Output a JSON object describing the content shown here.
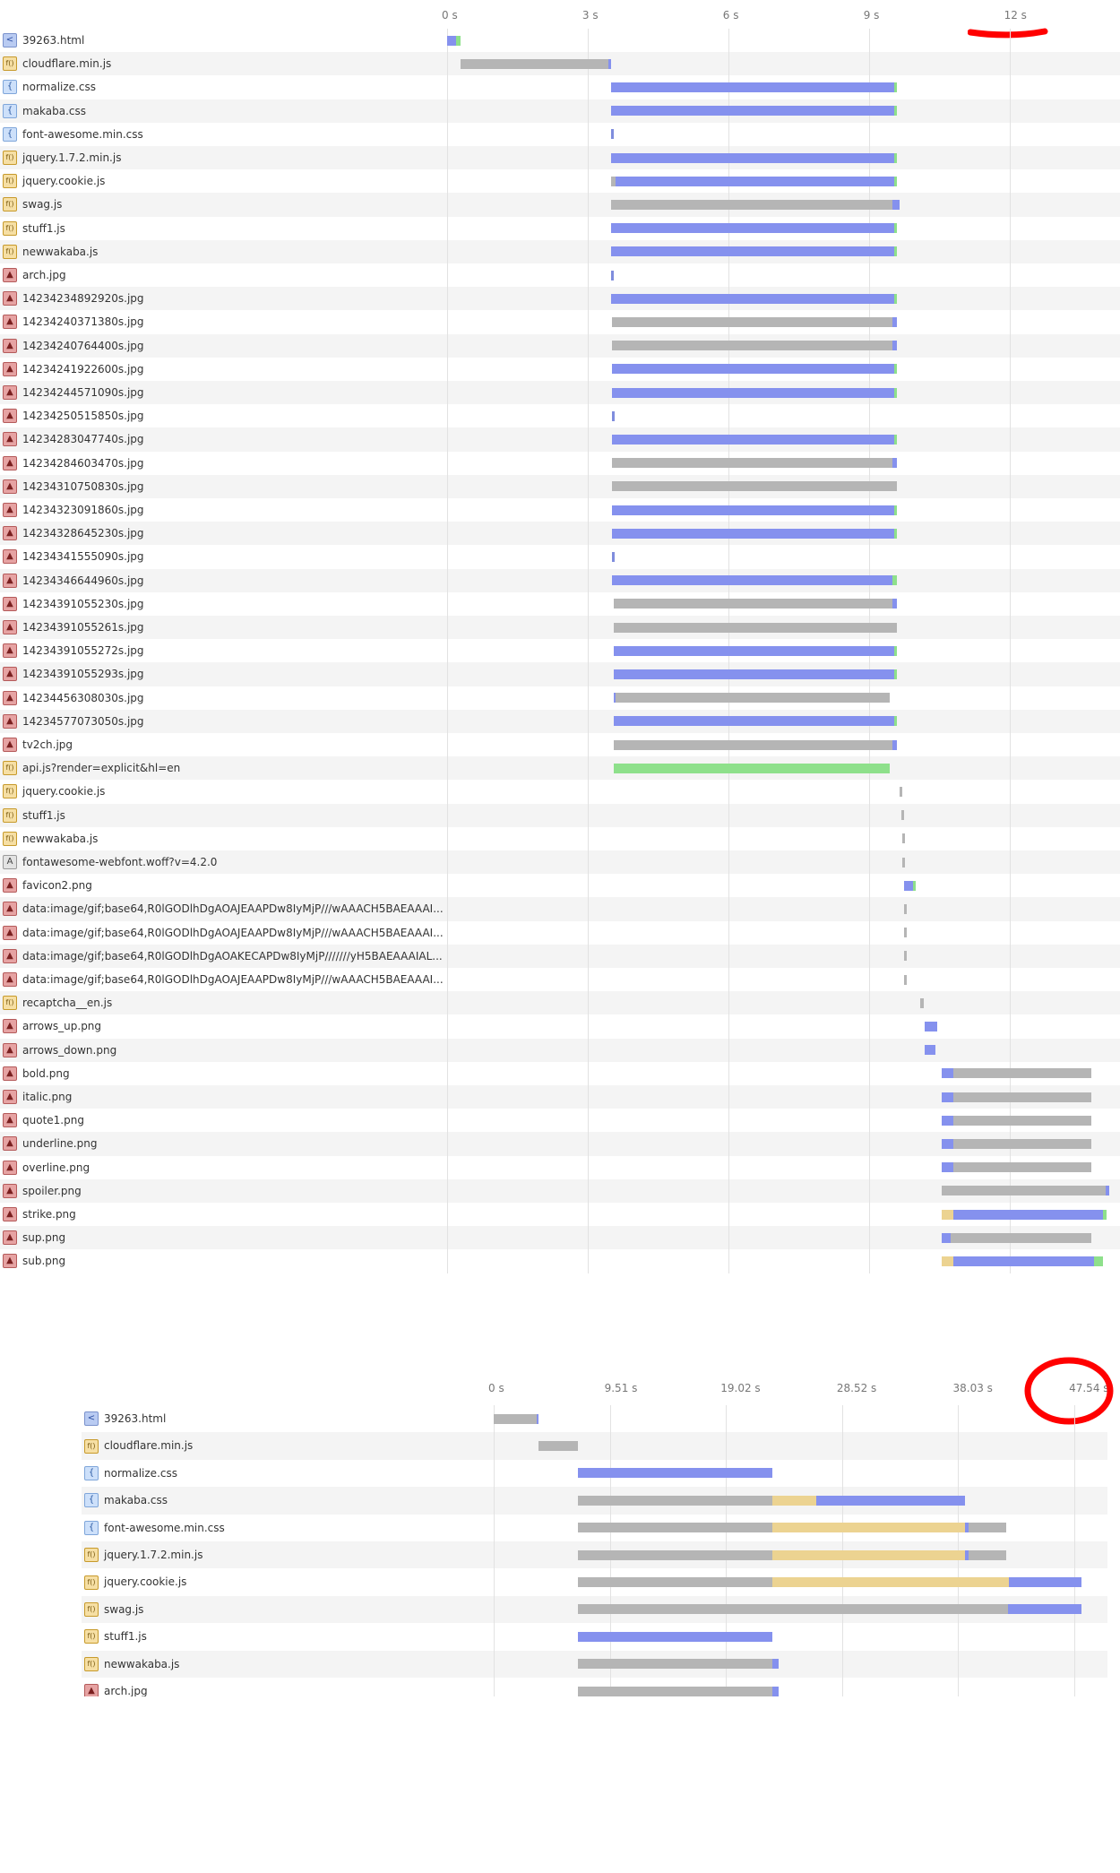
{
  "panel1": {
    "ticks": [
      "0 s",
      "3 s",
      "6 s",
      "9 s",
      "12 s"
    ],
    "rows": [
      {
        "name": "39263.html",
        "icon": "html",
        "segs": [
          [
            "blue",
            0,
            0.19
          ],
          [
            "green",
            0.19,
            0.28
          ]
        ]
      },
      {
        "name": "cloudflare.min.js",
        "icon": "js",
        "segs": [
          [
            "gray",
            0.28,
            3.45
          ],
          [
            "blue",
            3.45,
            3.5
          ]
        ]
      },
      {
        "name": "normalize.css",
        "icon": "css",
        "segs": [
          [
            "blue",
            3.5,
            9.55
          ],
          [
            "green",
            9.55,
            9.6
          ]
        ]
      },
      {
        "name": "makaba.css",
        "icon": "css",
        "segs": [
          [
            "blue",
            3.5,
            9.55
          ],
          [
            "green",
            9.55,
            9.6
          ]
        ]
      },
      {
        "name": "font-awesome.min.css",
        "icon": "css",
        "segs": [
          [
            "tick",
            3.5,
            3.56
          ]
        ]
      },
      {
        "name": "jquery.1.7.2.min.js",
        "icon": "js",
        "segs": [
          [
            "blue",
            3.5,
            9.55
          ],
          [
            "green",
            9.55,
            9.6
          ]
        ]
      },
      {
        "name": "jquery.cookie.js",
        "icon": "js",
        "segs": [
          [
            "gray",
            3.5,
            3.6
          ],
          [
            "blue",
            3.6,
            9.55
          ],
          [
            "green",
            9.55,
            9.6
          ]
        ]
      },
      {
        "name": "swag.js",
        "icon": "js",
        "segs": [
          [
            "gray",
            3.5,
            9.5
          ],
          [
            "blue",
            9.5,
            9.65
          ]
        ]
      },
      {
        "name": "stuff1.js",
        "icon": "js",
        "segs": [
          [
            "blue",
            3.5,
            9.55
          ],
          [
            "green",
            9.55,
            9.6
          ]
        ]
      },
      {
        "name": "newwakaba.js",
        "icon": "js",
        "segs": [
          [
            "blue",
            3.5,
            9.55
          ],
          [
            "green",
            9.55,
            9.6
          ]
        ]
      },
      {
        "name": "arch.jpg",
        "icon": "img",
        "segs": [
          [
            "tick",
            3.5,
            3.56
          ]
        ]
      },
      {
        "name": "14234234892920s.jpg",
        "icon": "img",
        "segs": [
          [
            "blue",
            3.5,
            9.55
          ],
          [
            "green",
            9.55,
            9.6
          ]
        ]
      },
      {
        "name": "14234240371380s.jpg",
        "icon": "img",
        "segs": [
          [
            "gray",
            3.52,
            9.5
          ],
          [
            "blue",
            9.5,
            9.6
          ]
        ]
      },
      {
        "name": "14234240764400s.jpg",
        "icon": "img",
        "segs": [
          [
            "gray",
            3.52,
            9.5
          ],
          [
            "blue",
            9.5,
            9.6
          ]
        ]
      },
      {
        "name": "14234241922600s.jpg",
        "icon": "img",
        "segs": [
          [
            "blue",
            3.52,
            9.55
          ],
          [
            "green",
            9.55,
            9.6
          ]
        ]
      },
      {
        "name": "14234244571090s.jpg",
        "icon": "img",
        "segs": [
          [
            "blue",
            3.52,
            9.55
          ],
          [
            "green",
            9.55,
            9.6
          ]
        ]
      },
      {
        "name": "14234250515850s.jpg",
        "icon": "img",
        "segs": [
          [
            "tick",
            3.52,
            3.58
          ]
        ]
      },
      {
        "name": "14234283047740s.jpg",
        "icon": "img",
        "segs": [
          [
            "blue",
            3.52,
            9.55
          ],
          [
            "green",
            9.55,
            9.6
          ]
        ]
      },
      {
        "name": "14234284603470s.jpg",
        "icon": "img",
        "segs": [
          [
            "gray",
            3.52,
            9.5
          ],
          [
            "blue",
            9.5,
            9.6
          ]
        ]
      },
      {
        "name": "14234310750830s.jpg",
        "icon": "img",
        "segs": [
          [
            "gray",
            3.52,
            9.6
          ]
        ]
      },
      {
        "name": "14234323091860s.jpg",
        "icon": "img",
        "segs": [
          [
            "blue",
            3.52,
            9.55
          ],
          [
            "green",
            9.55,
            9.6
          ]
        ]
      },
      {
        "name": "14234328645230s.jpg",
        "icon": "img",
        "segs": [
          [
            "blue",
            3.52,
            9.55
          ],
          [
            "green",
            9.55,
            9.6
          ]
        ]
      },
      {
        "name": "14234341555090s.jpg",
        "icon": "img",
        "segs": [
          [
            "tick",
            3.52,
            3.58
          ]
        ]
      },
      {
        "name": "14234346644960s.jpg",
        "icon": "img",
        "segs": [
          [
            "blue",
            3.52,
            9.5
          ],
          [
            "green",
            9.5,
            9.6
          ]
        ]
      },
      {
        "name": "14234391055230s.jpg",
        "icon": "img",
        "segs": [
          [
            "gray",
            3.55,
            9.5
          ],
          [
            "blue",
            9.5,
            9.6
          ]
        ]
      },
      {
        "name": "14234391055261s.jpg",
        "icon": "img",
        "segs": [
          [
            "gray",
            3.55,
            9.6
          ]
        ]
      },
      {
        "name": "14234391055272s.jpg",
        "icon": "img",
        "segs": [
          [
            "blue",
            3.55,
            9.55
          ],
          [
            "green",
            9.55,
            9.6
          ]
        ]
      },
      {
        "name": "14234391055293s.jpg",
        "icon": "img",
        "segs": [
          [
            "blue",
            3.55,
            9.55
          ],
          [
            "green",
            9.55,
            9.6
          ]
        ]
      },
      {
        "name": "14234456308030s.jpg",
        "icon": "img",
        "segs": [
          [
            "blue",
            3.55,
            3.6
          ],
          [
            "gray",
            3.6,
            9.45
          ]
        ]
      },
      {
        "name": "14234577073050s.jpg",
        "icon": "img",
        "segs": [
          [
            "blue",
            3.55,
            9.55
          ],
          [
            "green",
            9.55,
            9.6
          ]
        ]
      },
      {
        "name": "tv2ch.jpg",
        "icon": "img",
        "segs": [
          [
            "gray",
            3.55,
            9.5
          ],
          [
            "blue",
            9.5,
            9.6
          ]
        ]
      },
      {
        "name": "api.js?render=explicit&hl=en",
        "icon": "js",
        "segs": [
          [
            "green",
            3.55,
            9.45
          ]
        ]
      },
      {
        "name": "jquery.cookie.js",
        "icon": "js",
        "segs": [
          [
            "gray",
            9.65,
            9.72
          ]
        ]
      },
      {
        "name": "stuff1.js",
        "icon": "js",
        "segs": [
          [
            "gray",
            9.7,
            9.76
          ]
        ]
      },
      {
        "name": "newwakaba.js",
        "icon": "js",
        "segs": [
          [
            "gray",
            9.72,
            9.78
          ]
        ]
      },
      {
        "name": "fontawesome-webfont.woff?v=4.2.0",
        "icon": "font",
        "segs": [
          [
            "gray",
            9.72,
            9.78
          ]
        ]
      },
      {
        "name": "favicon2.png",
        "icon": "img",
        "segs": [
          [
            "blue",
            9.75,
            9.95
          ],
          [
            "green",
            9.95,
            10.0
          ]
        ]
      },
      {
        "name": "data:image/gif;base64,R0lGODlhDgAOAJEAAPDw8IyMjP///wAAACH5BAEAAAI...",
        "icon": "img",
        "segs": [
          [
            "gray",
            9.75,
            9.8
          ]
        ]
      },
      {
        "name": "data:image/gif;base64,R0lGODlhDgAOAJEAAPDw8IyMjP///wAAACH5BAEAAAI...",
        "icon": "img",
        "segs": [
          [
            "gray",
            9.75,
            9.8
          ]
        ]
      },
      {
        "name": "data:image/gif;base64,R0lGODlhDgAOAKECAPDw8IyMjP///////yH5BAEAAAIAL...",
        "icon": "img",
        "segs": [
          [
            "gray",
            9.75,
            9.8
          ]
        ]
      },
      {
        "name": "data:image/gif;base64,R0lGODlhDgAOAJEAAPDw8IyMjP///wAAACH5BAEAAAI...",
        "icon": "img",
        "segs": [
          [
            "gray",
            9.75,
            9.8
          ]
        ]
      },
      {
        "name": "recaptcha__en.js",
        "icon": "js",
        "segs": [
          [
            "gray",
            10.1,
            10.18
          ]
        ]
      },
      {
        "name": "arrows_up.png",
        "icon": "img",
        "segs": [
          [
            "blue",
            10.2,
            10.45
          ]
        ]
      },
      {
        "name": "arrows_down.png",
        "icon": "img",
        "segs": [
          [
            "blue",
            10.2,
            10.42
          ]
        ]
      },
      {
        "name": "bold.png",
        "icon": "img",
        "segs": [
          [
            "blue",
            10.55,
            10.8
          ],
          [
            "gray",
            10.8,
            13.75
          ]
        ]
      },
      {
        "name": "italic.png",
        "icon": "img",
        "segs": [
          [
            "blue",
            10.55,
            10.8
          ],
          [
            "gray",
            10.8,
            13.75
          ]
        ]
      },
      {
        "name": "quote1.png",
        "icon": "img",
        "segs": [
          [
            "blue",
            10.55,
            10.8
          ],
          [
            "gray",
            10.8,
            13.75
          ]
        ]
      },
      {
        "name": "underline.png",
        "icon": "img",
        "segs": [
          [
            "blue",
            10.55,
            10.8
          ],
          [
            "gray",
            10.8,
            13.75
          ]
        ]
      },
      {
        "name": "overline.png",
        "icon": "img",
        "segs": [
          [
            "blue",
            10.55,
            10.8
          ],
          [
            "gray",
            10.8,
            13.75
          ]
        ]
      },
      {
        "name": "spoiler.png",
        "icon": "img",
        "segs": [
          [
            "gray",
            10.55,
            14.05
          ],
          [
            "blue",
            14.05,
            14.13
          ]
        ]
      },
      {
        "name": "strike.png",
        "icon": "img",
        "segs": [
          [
            "tan",
            10.55,
            10.8
          ],
          [
            "blue",
            10.8,
            14.0
          ],
          [
            "green",
            14.0,
            14.08
          ]
        ]
      },
      {
        "name": "sup.png",
        "icon": "img",
        "segs": [
          [
            "blue",
            10.55,
            10.75
          ],
          [
            "gray",
            10.75,
            13.75
          ]
        ]
      },
      {
        "name": "sub.png",
        "icon": "img",
        "segs": [
          [
            "tan",
            10.55,
            10.8
          ],
          [
            "blue",
            10.8,
            13.8
          ],
          [
            "green",
            13.8,
            14.0
          ]
        ]
      }
    ]
  },
  "panel2": {
    "ticks": [
      "0 s",
      "9.51 s",
      "19.02 s",
      "28.52 s",
      "38.03 s",
      "47.54 s"
    ],
    "rows": [
      {
        "name": "39263.html",
        "icon": "html",
        "segs": [
          [
            "gray",
            0,
            3.5
          ],
          [
            "blue",
            3.5,
            3.7
          ]
        ]
      },
      {
        "name": "cloudflare.min.js",
        "icon": "js",
        "segs": [
          [
            "gray",
            3.7,
            6.9
          ]
        ]
      },
      {
        "name": "normalize.css",
        "icon": "css",
        "segs": [
          [
            "blue",
            6.9,
            22.8
          ]
        ]
      },
      {
        "name": "makaba.css",
        "icon": "css",
        "segs": [
          [
            "gray",
            6.9,
            22.8
          ],
          [
            "tan",
            22.8,
            26.4
          ],
          [
            "blue",
            26.4,
            38.6
          ]
        ]
      },
      {
        "name": "font-awesome.min.css",
        "icon": "css",
        "segs": [
          [
            "gray",
            6.9,
            22.8
          ],
          [
            "tan",
            22.8,
            38.6
          ],
          [
            "blue",
            38.6,
            38.9
          ],
          [
            "gray",
            38.9,
            42.0
          ]
        ]
      },
      {
        "name": "jquery.1.7.2.min.js",
        "icon": "js",
        "segs": [
          [
            "gray",
            6.9,
            22.8
          ],
          [
            "tan",
            22.8,
            38.6
          ],
          [
            "blue",
            38.6,
            38.9
          ],
          [
            "gray",
            38.9,
            42.0
          ]
        ]
      },
      {
        "name": "jquery.cookie.js",
        "icon": "js",
        "segs": [
          [
            "gray",
            6.9,
            22.8
          ],
          [
            "tan",
            22.8,
            42.2
          ],
          [
            "blue",
            42.2,
            48.1
          ]
        ]
      },
      {
        "name": "swag.js",
        "icon": "js",
        "segs": [
          [
            "gray",
            6.9,
            42.1
          ],
          [
            "blue",
            42.1,
            48.1
          ]
        ]
      },
      {
        "name": "stuff1.js",
        "icon": "js",
        "segs": [
          [
            "blue",
            6.9,
            22.8
          ]
        ]
      },
      {
        "name": "newwakaba.js",
        "icon": "js",
        "segs": [
          [
            "gray",
            6.9,
            22.8
          ],
          [
            "blue",
            22.8,
            23.3
          ]
        ]
      },
      {
        "name": "arch.jpg",
        "icon": "img",
        "segs": [
          [
            "gray",
            6.9,
            22.8
          ],
          [
            "blue",
            22.8,
            23.3
          ]
        ]
      }
    ]
  },
  "icons": {
    "html": "<",
    "js": "f()",
    "css": "{",
    "img": "▲",
    "font": "A"
  },
  "colors": {
    "gray": "#b5b5b5",
    "blue": "#8591ee",
    "green": "#8ee08b",
    "tan": "#ecd391",
    "highlight": "#ff0000"
  }
}
